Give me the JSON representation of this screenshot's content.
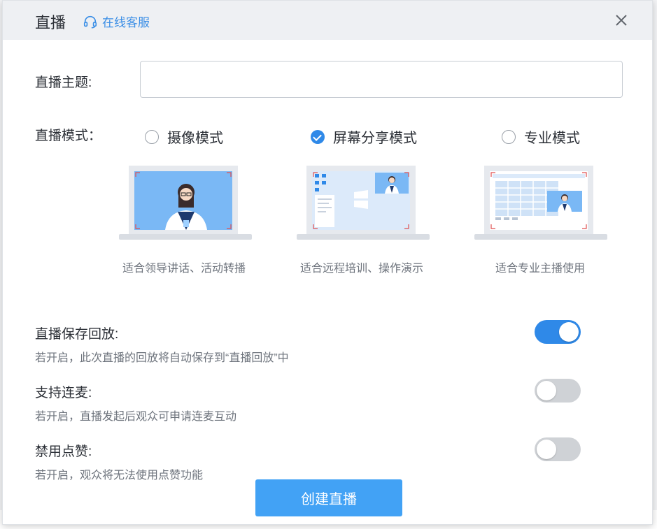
{
  "dialog": {
    "title": "直播",
    "service_label": "在线客服"
  },
  "form": {
    "topic_label": "直播主题:",
    "topic_value": "",
    "topic_placeholder": "",
    "mode_label": "直播模式："
  },
  "modes": [
    {
      "label": "摄像模式",
      "caption": "适合领导讲话、活动转播",
      "selected": false
    },
    {
      "label": "屏幕分享模式",
      "caption": "适合远程培训、操作演示",
      "selected": true
    },
    {
      "label": "专业模式",
      "caption": "适合专业主播使用",
      "selected": false
    }
  ],
  "settings": [
    {
      "title": "直播保存回放:",
      "desc": "若开启，此次直播的回放将自动保存到“直播回放”中",
      "enabled": true
    },
    {
      "title": "支持连麦:",
      "desc": "若开启，直播发起后观众可申请连麦互动",
      "enabled": false
    },
    {
      "title": "禁用点赞:",
      "desc": "若开启，观众将无法使用点赞功能",
      "enabled": false
    }
  ],
  "create_button": "创建直播",
  "colors": {
    "accent": "#2f89e8",
    "button": "#42a2f5",
    "header_bg": "#eef0f3"
  }
}
